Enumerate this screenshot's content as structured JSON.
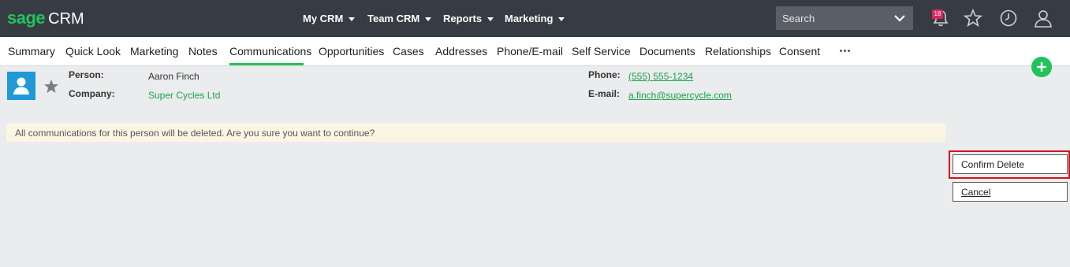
{
  "brand": {
    "logo_sage": "sage",
    "logo_crm": "CRM",
    "accent": "#22c45a"
  },
  "topnav": [
    {
      "label": "My CRM"
    },
    {
      "label": "Team CRM"
    },
    {
      "label": "Reports"
    },
    {
      "label": "Marketing"
    }
  ],
  "search": {
    "placeholder": "Search"
  },
  "notifications": {
    "count": "18"
  },
  "tabs": [
    {
      "label": "Summary"
    },
    {
      "label": "Quick Look"
    },
    {
      "label": "Marketing"
    },
    {
      "label": "Notes"
    },
    {
      "label": "Communications",
      "active": true
    },
    {
      "label": "Opportunities"
    },
    {
      "label": "Cases"
    },
    {
      "label": "Addresses"
    },
    {
      "label": "Phone/E-mail"
    },
    {
      "label": "Self Service"
    },
    {
      "label": "Documents"
    },
    {
      "label": "Relationships"
    },
    {
      "label": "Consent"
    }
  ],
  "entity": {
    "person_label": "Person:",
    "person_value": "Aaron Finch",
    "company_label": "Company:",
    "company_value": "Super Cycles Ltd",
    "phone_label": "Phone:",
    "phone_value": "(555) 555-1234",
    "email_label": "E-mail:",
    "email_value": "a.finch@supercycle.com"
  },
  "message": {
    "text": "All communications for this person will be deleted. Are you sure you want to continue?"
  },
  "actions": {
    "confirm_label": "Confirm Delete",
    "cancel_label": "Cancel"
  }
}
